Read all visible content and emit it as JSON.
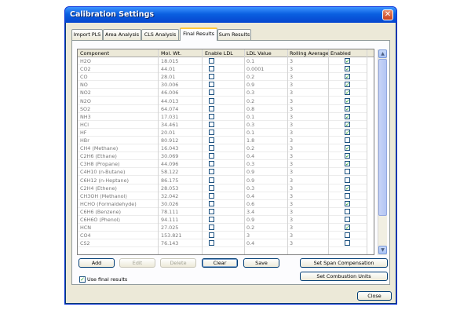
{
  "window": {
    "title": "Calibration Settings"
  },
  "tabs": [
    {
      "label": "Import PLS",
      "active": false
    },
    {
      "label": "Area Analysis",
      "active": false
    },
    {
      "label": "CLS Analysis",
      "active": false
    },
    {
      "label": "Final Results",
      "active": true
    },
    {
      "label": "Sum Results",
      "active": false
    }
  ],
  "grid": {
    "columns": [
      "Component",
      "Mol. Wt.",
      "Enable LDL",
      "LDL Value",
      "Rolling Average",
      "Enabled"
    ],
    "rows": [
      {
        "component": "H2O",
        "mol_wt": "18.015",
        "enable_ldl": false,
        "ldl_value": "0.1",
        "rolling_average": "3",
        "enabled": true
      },
      {
        "component": "CO2",
        "mol_wt": "44.01",
        "enable_ldl": false,
        "ldl_value": "0.0001",
        "rolling_average": "3",
        "enabled": true
      },
      {
        "component": "CO",
        "mol_wt": "28.01",
        "enable_ldl": false,
        "ldl_value": "0.2",
        "rolling_average": "3",
        "enabled": true
      },
      {
        "component": "NO",
        "mol_wt": "30.006",
        "enable_ldl": false,
        "ldl_value": "0.9",
        "rolling_average": "3",
        "enabled": true
      },
      {
        "component": "NO2",
        "mol_wt": "46.006",
        "enable_ldl": false,
        "ldl_value": "0.3",
        "rolling_average": "3",
        "enabled": true
      },
      {
        "component": "N2O",
        "mol_wt": "44.013",
        "enable_ldl": false,
        "ldl_value": "0.2",
        "rolling_average": "3",
        "enabled": true
      },
      {
        "component": "SO2",
        "mol_wt": "64.074",
        "enable_ldl": false,
        "ldl_value": "0.8",
        "rolling_average": "3",
        "enabled": true
      },
      {
        "component": "NH3",
        "mol_wt": "17.031",
        "enable_ldl": false,
        "ldl_value": "0.1",
        "rolling_average": "3",
        "enabled": true
      },
      {
        "component": "HCl",
        "mol_wt": "34.461",
        "enable_ldl": false,
        "ldl_value": "0.3",
        "rolling_average": "3",
        "enabled": true
      },
      {
        "component": "HF",
        "mol_wt": "20.01",
        "enable_ldl": false,
        "ldl_value": "0.1",
        "rolling_average": "3",
        "enabled": true
      },
      {
        "component": "HBr",
        "mol_wt": "80.912",
        "enable_ldl": false,
        "ldl_value": "1.8",
        "rolling_average": "3",
        "enabled": false
      },
      {
        "component": "CH4 (Methane)",
        "mol_wt": "16.043",
        "enable_ldl": false,
        "ldl_value": "0.2",
        "rolling_average": "3",
        "enabled": true
      },
      {
        "component": "C2H6 (Ethane)",
        "mol_wt": "30.069",
        "enable_ldl": false,
        "ldl_value": "0.4",
        "rolling_average": "3",
        "enabled": true
      },
      {
        "component": "C3H8 (Propane)",
        "mol_wt": "44.096",
        "enable_ldl": false,
        "ldl_value": "0.3",
        "rolling_average": "3",
        "enabled": true
      },
      {
        "component": "C4H10 (n-Butane)",
        "mol_wt": "58.122",
        "enable_ldl": false,
        "ldl_value": "0.9",
        "rolling_average": "3",
        "enabled": false
      },
      {
        "component": "C6H12 (n-Heptane)",
        "mol_wt": "86.175",
        "enable_ldl": false,
        "ldl_value": "0.9",
        "rolling_average": "3",
        "enabled": false
      },
      {
        "component": "C2H4 (Ethene)",
        "mol_wt": "28.053",
        "enable_ldl": false,
        "ldl_value": "0.3",
        "rolling_average": "3",
        "enabled": true
      },
      {
        "component": "CH3OH (Methanol)",
        "mol_wt": "32.042",
        "enable_ldl": false,
        "ldl_value": "0.4",
        "rolling_average": "3",
        "enabled": false
      },
      {
        "component": "HCHO (Formaldehyde)",
        "mol_wt": "30.026",
        "enable_ldl": false,
        "ldl_value": "0.6",
        "rolling_average": "3",
        "enabled": true
      },
      {
        "component": "C6H6 (Benzene)",
        "mol_wt": "78.111",
        "enable_ldl": false,
        "ldl_value": "3.4",
        "rolling_average": "3",
        "enabled": false
      },
      {
        "component": "C6H6O (Phenol)",
        "mol_wt": "94.111",
        "enable_ldl": false,
        "ldl_value": "0.9",
        "rolling_average": "3",
        "enabled": false
      },
      {
        "component": "HCN",
        "mol_wt": "27.025",
        "enable_ldl": false,
        "ldl_value": "0.2",
        "rolling_average": "3",
        "enabled": true
      },
      {
        "component": "CO4",
        "mol_wt": "153.821",
        "enable_ldl": false,
        "ldl_value": "3",
        "rolling_average": "3",
        "enabled": false
      },
      {
        "component": "CS2",
        "mol_wt": "76.143",
        "enable_ldl": false,
        "ldl_value": "0.4",
        "rolling_average": "3",
        "enabled": false
      }
    ]
  },
  "buttons": {
    "add": "Add",
    "edit": "Edit",
    "delete": "Delete",
    "clear": "Clear",
    "save": "Save",
    "span": "Set Span Compensation",
    "combustion": "Set Combustion Units",
    "close": "Close"
  },
  "use_final_results": {
    "label": "Use final results",
    "checked": true
  },
  "colors": {
    "title_bar": "#0a5fe0",
    "window_bg": "#ece9d8",
    "check_mark": "#21a121"
  }
}
